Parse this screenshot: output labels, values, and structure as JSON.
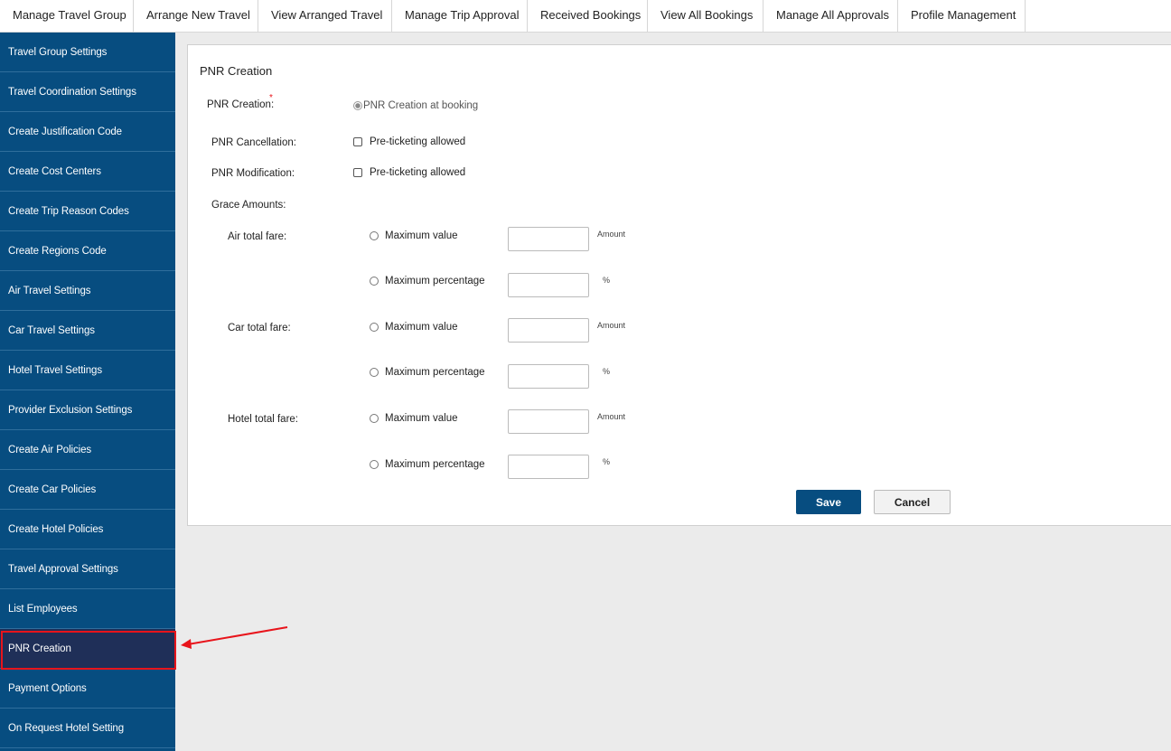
{
  "topnav": {
    "tabs": [
      {
        "label": "Manage Travel Group"
      },
      {
        "label": "Arrange New Travel"
      },
      {
        "label": "View Arranged Travel"
      },
      {
        "label": "Manage Trip Approval"
      },
      {
        "label": "Received Bookings"
      },
      {
        "label": "View All Bookings"
      },
      {
        "label": "Manage All Approvals"
      },
      {
        "label": "Profile Management"
      }
    ]
  },
  "sidebar": {
    "items": [
      {
        "label": "Travel Group Settings"
      },
      {
        "label": "Travel Coordination Settings"
      },
      {
        "label": "Create Justification Code"
      },
      {
        "label": "Create Cost Centers"
      },
      {
        "label": "Create Trip Reason Codes"
      },
      {
        "label": "Create Regions Code"
      },
      {
        "label": "Air Travel Settings"
      },
      {
        "label": "Car Travel Settings"
      },
      {
        "label": "Hotel Travel Settings"
      },
      {
        "label": "Provider Exclusion Settings"
      },
      {
        "label": "Create Air Policies"
      },
      {
        "label": "Create Car Policies"
      },
      {
        "label": "Create Hotel Policies"
      },
      {
        "label": "Travel Approval Settings"
      },
      {
        "label": "List Employees"
      },
      {
        "label": "PNR Creation"
      },
      {
        "label": "Payment Options"
      },
      {
        "label": "On Request Hotel Setting"
      }
    ],
    "active": "PNR Creation"
  },
  "form": {
    "title": "PNR Creation",
    "pnr_creation": {
      "label": "PNR Creation:",
      "required_mark": "*",
      "option": "PNR Creation at booking",
      "selected": true
    },
    "pnr_cancellation": {
      "label": "PNR Cancellation:",
      "option": "Pre-ticketing allowed",
      "checked": false
    },
    "pnr_modification": {
      "label": "PNR Modification:",
      "option": "Pre-ticketing allowed",
      "checked": false
    },
    "grace_amounts_label": "Grace Amounts:",
    "grace": [
      {
        "label": "Air total fare:",
        "max_value_label": "Maximum value",
        "max_value": "",
        "value_unit": "Amount",
        "max_pct_label": "Maximum percentage",
        "max_pct": "",
        "pct_unit": "%"
      },
      {
        "label": "Car total fare:",
        "max_value_label": "Maximum value",
        "max_value": "",
        "value_unit": "Amount",
        "max_pct_label": "Maximum percentage",
        "max_pct": "",
        "pct_unit": "%"
      },
      {
        "label": "Hotel total fare:",
        "max_value_label": "Maximum value",
        "max_value": "",
        "value_unit": "Amount",
        "max_pct_label": "Maximum percentage",
        "max_pct": "",
        "pct_unit": "%"
      }
    ],
    "save_label": "Save",
    "cancel_label": "Cancel"
  },
  "colors": {
    "sidebar_bg": "#074d80",
    "sidebar_active": "#1f2f58",
    "highlight": "#e8141b",
    "save_button": "#074d80"
  }
}
